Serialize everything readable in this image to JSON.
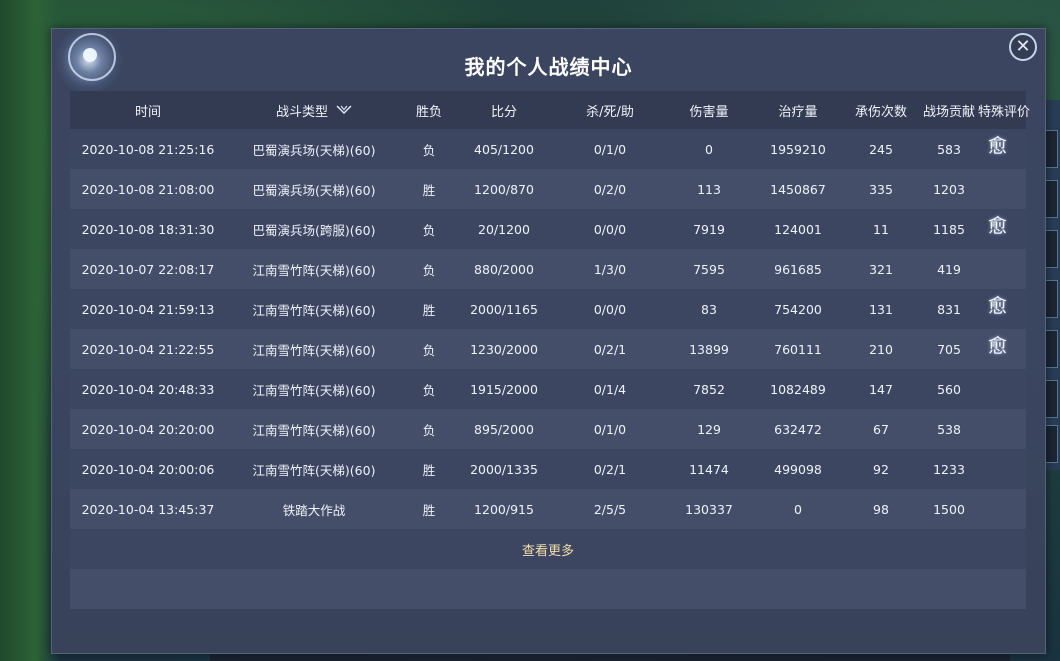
{
  "panel": {
    "title": "我的个人战绩中心",
    "close_label": "✕"
  },
  "columns": {
    "time": "时间",
    "type": "战斗类型",
    "result": "胜负",
    "score": "比分",
    "kda": "杀/死/助",
    "damage": "伤害量",
    "healing": "治疗量",
    "taken": "承伤次数",
    "contribution": "战场贡献",
    "special": "特殊评价"
  },
  "rows": [
    {
      "time": "2020-10-08 21:25:16",
      "type": "巴蜀演兵场(天梯)(60)",
      "result": "负",
      "score": "405/1200",
      "kda": "0/1/0",
      "damage": "0",
      "healing": "1959210",
      "taken": "245",
      "contribution": "583",
      "badge": "愈"
    },
    {
      "time": "2020-10-08 21:08:00",
      "type": "巴蜀演兵场(天梯)(60)",
      "result": "胜",
      "score": "1200/870",
      "kda": "0/2/0",
      "damage": "113",
      "healing": "1450867",
      "taken": "335",
      "contribution": "1203",
      "badge": ""
    },
    {
      "time": "2020-10-08 18:31:30",
      "type": "巴蜀演兵场(跨服)(60)",
      "result": "负",
      "score": "20/1200",
      "kda": "0/0/0",
      "damage": "7919",
      "healing": "124001",
      "taken": "11",
      "contribution": "1185",
      "badge": "愈"
    },
    {
      "time": "2020-10-07 22:08:17",
      "type": "江南雪竹阵(天梯)(60)",
      "result": "负",
      "score": "880/2000",
      "kda": "1/3/0",
      "damage": "7595",
      "healing": "961685",
      "taken": "321",
      "contribution": "419",
      "badge": ""
    },
    {
      "time": "2020-10-04 21:59:13",
      "type": "江南雪竹阵(天梯)(60)",
      "result": "胜",
      "score": "2000/1165",
      "kda": "0/0/0",
      "damage": "83",
      "healing": "754200",
      "taken": "131",
      "contribution": "831",
      "badge": "愈"
    },
    {
      "time": "2020-10-04 21:22:55",
      "type": "江南雪竹阵(天梯)(60)",
      "result": "负",
      "score": "1230/2000",
      "kda": "0/2/1",
      "damage": "13899",
      "healing": "760111",
      "taken": "210",
      "contribution": "705",
      "badge": "愈"
    },
    {
      "time": "2020-10-04 20:48:33",
      "type": "江南雪竹阵(天梯)(60)",
      "result": "负",
      "score": "1915/2000",
      "kda": "0/1/4",
      "damage": "7852",
      "healing": "1082489",
      "taken": "147",
      "contribution": "560",
      "badge": ""
    },
    {
      "time": "2020-10-04 20:20:00",
      "type": "江南雪竹阵(天梯)(60)",
      "result": "负",
      "score": "895/2000",
      "kda": "0/1/0",
      "damage": "129",
      "healing": "632472",
      "taken": "67",
      "contribution": "538",
      "badge": ""
    },
    {
      "time": "2020-10-04 20:00:06",
      "type": "江南雪竹阵(天梯)(60)",
      "result": "胜",
      "score": "2000/1335",
      "kda": "0/2/1",
      "damage": "11474",
      "healing": "499098",
      "taken": "92",
      "contribution": "1233",
      "badge": ""
    },
    {
      "time": "2020-10-04 13:45:37",
      "type": "铁踏大作战",
      "result": "胜",
      "score": "1200/915",
      "kda": "2/5/5",
      "damage": "130337",
      "healing": "0",
      "taken": "98",
      "contribution": "1500",
      "badge": ""
    }
  ],
  "more_label": "查看更多",
  "colors": {
    "panel_bg": "#3a4560",
    "row_odd": "#3c4661",
    "row_even": "#444e69",
    "header_bg": "#323b51",
    "link": "#f3deaa"
  },
  "icons": {
    "close": "close-icon",
    "sort": "sort-dropdown-icon",
    "badge": "healer-badge-icon",
    "orb": "compass-orb-icon"
  }
}
